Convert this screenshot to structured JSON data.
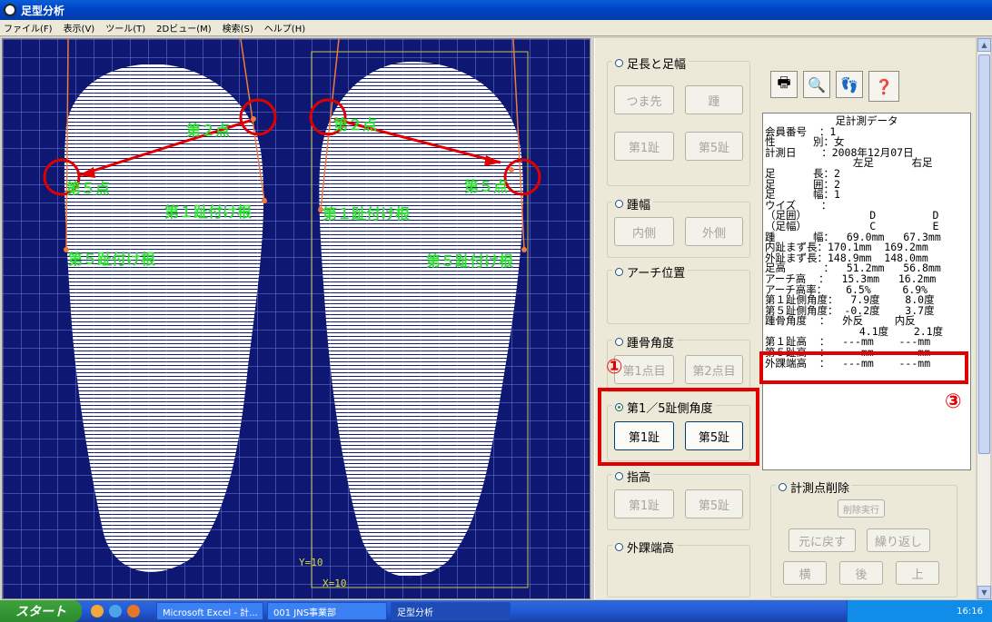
{
  "window": {
    "title": "足型分析"
  },
  "menu": [
    "ファイル(F)",
    "表示(V)",
    "ツール(T)",
    "2Dビュー(M)",
    "検索(S)",
    "ヘルプ(H)"
  ],
  "canvas": {
    "labels": {
      "left_pt2": "第２点",
      "left_pt5": "第５点",
      "right_pt2": "第２点",
      "right_pt5": "第５点",
      "left_toe1": "第１趾付け根",
      "left_toe5": "第５趾付け根",
      "right_toe1": "第１趾付け根",
      "right_toe5": "第５趾付け根"
    },
    "y_marker": "Y=10",
    "x_marker": "X=10"
  },
  "panel": {
    "groups": {
      "length": "足長と足幅",
      "heel_width": "踵幅",
      "arch": "アーチ位置",
      "heel_angle": "踵骨角度",
      "toe_angle": "第1／5趾側角度",
      "finger_height": "指高",
      "ankle": "外踝端高",
      "delete": "計測点削除"
    },
    "buttons": {
      "toe_tip": "つま先",
      "heel": "踵",
      "toe1a": "第1趾",
      "toe5a": "第5趾",
      "inner": "内側",
      "outer": "外側",
      "point1": "第1点目",
      "point2": "第2点目",
      "toe1b": "第1趾",
      "toe5b": "第5趾",
      "toe1c": "第1趾",
      "toe5c": "第5趾",
      "delete_exec": "削除実行",
      "undo": "元に戻す",
      "redo": "繰り返し",
      "side": "横",
      "back": "後",
      "top": "上"
    },
    "tool_icons": [
      "printer-icon",
      "preview-icon",
      "foot-model-icon",
      "help-icon"
    ]
  },
  "data_panel": {
    "title": "足計測データ",
    "lines": [
      "会員番号  ：1",
      "性      別：女",
      "計測日    ：2008年12月07日",
      "              左足      右足",
      "足      長：2",
      "足      囲：2",
      "足      幅：1",
      "ウイズ    ：",
      "（足囲）          D         D",
      "（足幅）          C         E",
      "踵      幅：  69.0mm   67.3mm",
      "内趾まず長：170.1mm  169.2mm",
      "外趾まず長：148.9mm  148.0mm",
      "足高      ：  51.2mm   56.8mm",
      "アーチ高  ：  15.3mm   16.2mm",
      "アーチ高率：   6.5%     6.9%",
      "第１趾側角度：  7.9度    8.0度",
      "第５趾側角度： -0.2度    3.7度",
      "踵骨角度  ：  外反     内反",
      "               4.1度    2.1度",
      "第１趾高  ：  ---mm    ---mm",
      "第５趾高  ：  ---mm    ---mm",
      "外踝端高  ：  ---mm    ---mm"
    ]
  },
  "annotations": {
    "n1": "①",
    "n3": "③"
  },
  "taskbar": {
    "start": "スタート",
    "items": [
      "Microsoft Excel - 計...",
      "001 JNS事業部",
      "足型分析"
    ],
    "clock": "16:16"
  }
}
